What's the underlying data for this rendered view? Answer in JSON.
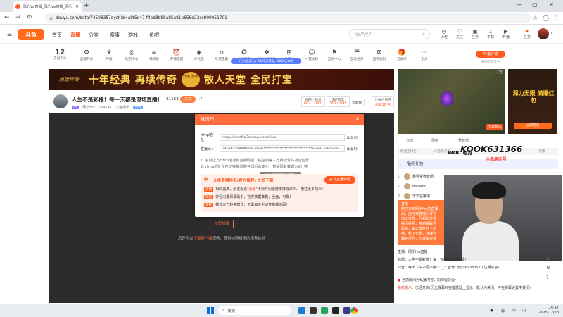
{
  "browser": {
    "tab_title": "网乐fps直播_网乐fps直播_网乐",
    "url": "douyu.com/beta/74598357dyshid=a9f5d47-f4bd8b88a85a81b656d23cc900051701"
  },
  "header": {
    "logo": "斗鱼",
    "menu": [
      "首页",
      "直播",
      "分类",
      "赛事",
      "游戏",
      "鱼吧"
    ],
    "search_placeholder": "yy/fyy/f",
    "tools": [
      "历史",
      "关注",
      "任务",
      "下载",
      "开播",
      "任务"
    ]
  },
  "feature_bar": {
    "level_num": "12",
    "level_label": "去送积分",
    "items": [
      "直播开关",
      "月榜",
      "动态中心",
      "播间榜",
      "开播提醒",
      "AI礼包",
      "礼物宝藏",
      "斗鱼赏金",
      "5000万预告",
      "投票中",
      "一键加粉",
      "互动中心",
      "互动任务",
      "团购福利",
      "泛娱乐",
      "更多"
    ],
    "badge": "5万斗鱼积分，5000万预告，5000万拿号",
    "pc_btn": "PC客户端",
    "pc_sub": "去网页领任务"
  },
  "banner": {
    "left_logo": "原始传奇",
    "text1": "十年经典 再续传奇",
    "badge": "开始 游戏",
    "text2": "散人天堂 全民打宝"
  },
  "room": {
    "title": "人生不是彩排！每一天都是现场直播！",
    "level": "Lv.",
    "name": "网乐fps",
    "id": "724541",
    "category": "斗鱼娱乐",
    "category_tag": "FPS",
    "followers": "31163",
    "follow_label": "关注",
    "stats": [
      {
        "label": "光阴 · 粉丝",
        "value": "682 / 1000"
      },
      {
        "label": "3星热度",
        "value": "360 / 1/45"
      },
      {
        "label": "全能榜",
        "value": ""
      },
      {
        "label": "斗鱼世界杯",
        "value": "排第10 名"
      }
    ]
  },
  "player": {
    "offline_prefix": "您还可以",
    "offline_link": "下载客户端",
    "offline_suffix": "观看，获得纯净极速的观看体验",
    "outline_btn": "立即加载"
  },
  "modal": {
    "title": "推流码",
    "rtmp_label": "rtmp地址：",
    "rtmp_value": "rtmp://sendfrw3a.douyu.com/live",
    "key_label": "直播码：",
    "key_value": "7459835nRWA0oW3dyP6z*****************************ecord=fv&roviec",
    "copy_label": "复制",
    "tips": [
      "1. 复制上方rtmp地址和直播码后，粘贴到第三方推流软件对应位置",
      "2. rtmp地址仅在切换推流服务器后会变化，直播码有效期为5分钟"
    ],
    "toast": "已成功复制rtmp地址",
    "promo": {
      "title": "斗鱼直播伴侣(官方推荐)  立即下载",
      "btn": "打开直播伴侣",
      "lines": [
        {
          "tag": "流畅",
          "pre": "相同画质，水友观看",
          "em": "\"原画\"",
          "post": "卡顿时间速度率降低20%，横往更多观众!"
        },
        {
          "tag": "玩法",
          "pre": "伴侣内置弹幕助手，官方数据准确，全面，可靠!",
          "em": "",
          "post": ""
        },
        {
          "tag": "便捷",
          "pre": "推荐三方转换模式，无需每天手动复制推流码!",
          "em": "",
          "post": ""
        }
      ]
    }
  },
  "right": {
    "ad_tag": "广告",
    "video_cta": "立即参与",
    "side_ad_text": "深力无限 满爆红包",
    "side_ad_btn": "立即游戏",
    "tabs": [
      "日榜",
      "周榜",
      "贡献榜"
    ],
    "rank_sub": [
      "粉丝团排名",
      "斗鱼热门榜",
      "开播"
    ],
    "promo_box": "钻粉礼包",
    "chat": [
      {
        "rank": "1",
        "name": "最强贤者奇组"
      },
      {
        "rank": "2",
        "name": "Bilulabo"
      },
      {
        "rank": "3",
        "name": "宁宁在哪中"
      }
    ],
    "orange_card_lines": [
      "直播",
      "欢迎来到网乐fps的直播",
      "间，还可到直播间评论",
      "加水友群，互相交流直",
      "播间经验，签到获取经",
      "验值，每天都能打卡的",
      "哦，私下交易，涉嫌诈",
      "骗等行为，均谨慎对待",
      "请勿加微信，谨防诈骗"
    ],
    "notices": [
      {
        "pre": "主播：",
        "text": "网乐fps直播",
        "red": ""
      },
      {
        "pre": "标题：",
        "text": "人生不是彩排！每一天都是现场直播！",
        "red": ""
      },
      {
        "pre": "公告：",
        "text": "每天下午不见不散! ^_^ 合作: qq 962380520 注明来意!",
        "red": ""
      },
      {
        "pre": "",
        "text": "当前房间为私播内容，同样留彩蛋~",
        "red": ""
      },
      {
        "pre": "",
        "text": "已经开启",
        "red": "系统提示：",
        "post": "(历史弹幕只在播放器上显示，默认为关闭，可在弹幕设置中关闭)"
      }
    ],
    "watermark": "KOOK631366",
    "watermark_sub": "斗鱼房间号",
    "woc": "WOC 电竞"
  },
  "taskbar": {
    "search": "搜索",
    "time": "14:57",
    "date": "2025/12/18",
    "lang": "中"
  }
}
